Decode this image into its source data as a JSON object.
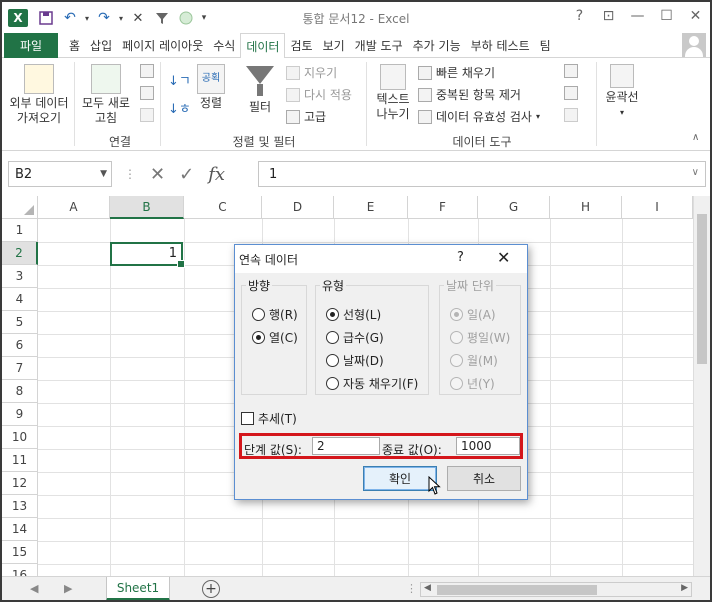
{
  "title_bar": {
    "app_icon": "X",
    "quick_access": [
      "save-icon",
      "undo-icon",
      "redo-icon",
      "close-icon",
      "filter-icon",
      "circle-icon",
      "customize-icon"
    ],
    "title": "통합 문서12 - Excel",
    "window_buttons": [
      "?",
      "⊡",
      "—",
      "☐",
      "✕"
    ]
  },
  "tabs": {
    "file": "파일",
    "items": [
      "홈",
      "삽입",
      "페이지 레이아웃",
      "수식",
      "데이터",
      "검토",
      "보기",
      "개발 도구",
      "추가 기능",
      "부하 테스트",
      "팀"
    ],
    "active": "데이터"
  },
  "ribbon": {
    "external_data": {
      "label_line1": "외부 데이터",
      "label_line2": "가져오기"
    },
    "refresh_all": {
      "label_line1": "모두 새로",
      "label_line2": "고침"
    },
    "connections_group": "연결",
    "sort_label": "정렬",
    "filter_label": "필터",
    "clear_label": "지우기",
    "reapply_label": "다시 적용",
    "advanced_label": "고급",
    "sort_filter_group": "정렬 및 필터",
    "text_to_columns": {
      "label_line1": "텍스트",
      "label_line2": "나누기"
    },
    "flash_fill": "빠른 채우기",
    "remove_duplicates": "중복된 항목 제거",
    "data_validation": "데이터 유효성 검사",
    "data_tools_group": "데이터 도구",
    "outline_label": "윤곽선"
  },
  "formula_bar": {
    "name_box": "B2",
    "fx": "fx",
    "value": "1"
  },
  "grid": {
    "columns": [
      "A",
      "B",
      "C",
      "D",
      "E",
      "F",
      "G",
      "H",
      "I"
    ],
    "rows": [
      "1",
      "2",
      "3",
      "4",
      "5",
      "6",
      "7",
      "8",
      "9",
      "10",
      "11",
      "12",
      "13",
      "14",
      "15",
      "16"
    ],
    "selected_column": "B",
    "selected_row": "2",
    "active_cell_value": "1"
  },
  "sheet_bar": {
    "sheet_name": "Sheet1",
    "add_sheet": "+"
  },
  "dialog": {
    "title": "연속 데이터",
    "help": "?",
    "close": "✕",
    "direction": {
      "legend": "방향",
      "options": [
        "행(R)",
        "열(C)"
      ],
      "selected": "열(C)"
    },
    "type": {
      "legend": "유형",
      "options": [
        "선형(L)",
        "급수(G)",
        "날짜(D)",
        "자동 채우기(F)"
      ],
      "selected": "선형(L)"
    },
    "date_unit": {
      "legend": "날짜 단위",
      "options": [
        "일(A)",
        "평일(W)",
        "월(M)",
        "년(Y)"
      ],
      "selected": "일(A)"
    },
    "trend_label": "추세(T)",
    "trend_checked": false,
    "step_label": "단계 값(S):",
    "step_value": "2",
    "stop_label": "종료 값(O):",
    "stop_value": "1000",
    "ok_label": "확인",
    "cancel_label": "취소"
  }
}
